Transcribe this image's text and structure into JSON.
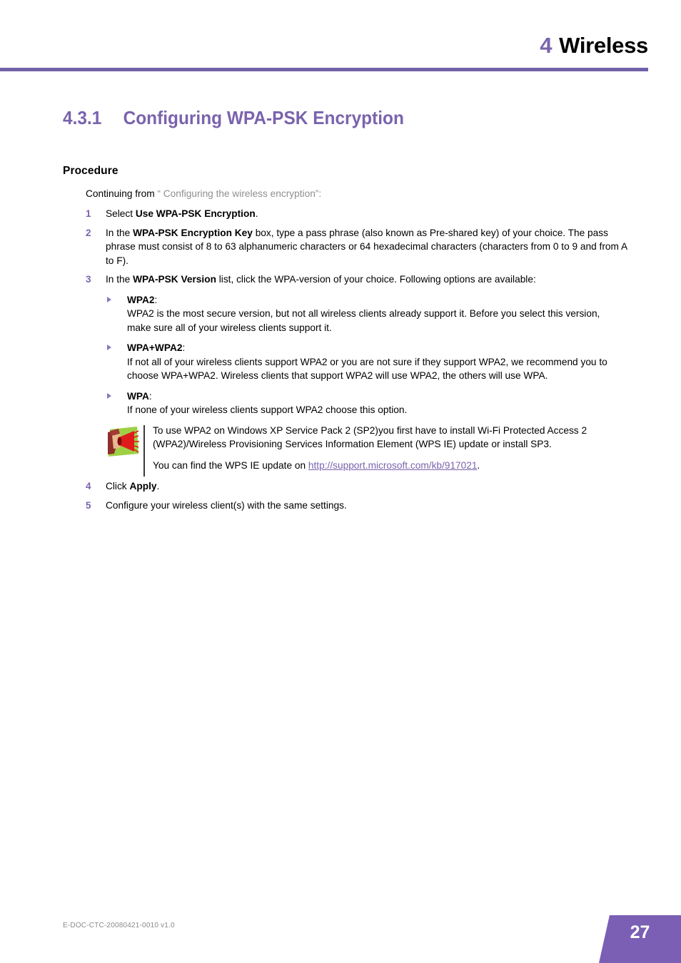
{
  "header": {
    "chapter_number": "4",
    "chapter_name": "Wireless",
    "accent_color": "#7161a8"
  },
  "section": {
    "number": "4.3.1",
    "title": "Configuring WPA-PSK Encryption"
  },
  "procedure": {
    "label": "Procedure",
    "intro_lead": "Continuing from",
    "intro_xref": "“ Configuring the wireless encryption”:",
    "steps": [
      {
        "number": "1",
        "parts": [
          {
            "text": "Select ",
            "bold": false
          },
          {
            "text": "Use WPA-PSK Encryption",
            "bold": true
          },
          {
            "text": ".",
            "bold": false
          }
        ]
      },
      {
        "number": "2",
        "parts": [
          {
            "text": "In the ",
            "bold": false
          },
          {
            "text": "WPA-PSK Encryption Key",
            "bold": true
          },
          {
            "text": " box, type a pass phrase (also known as Pre-shared key) of your choice. The pass phrase must consist of 8 to 63 alphanumeric characters or 64 hexadecimal characters (characters from 0 to 9 and from A to F).",
            "bold": false
          }
        ]
      },
      {
        "number": "3",
        "parts": [
          {
            "text": "In the ",
            "bold": false
          },
          {
            "text": "WPA-PSK Version",
            "bold": true
          },
          {
            "text": " list, click the WPA-version of your choice. Following options are available:",
            "bold": false
          }
        ]
      },
      {
        "number": "4",
        "parts": [
          {
            "text": "Click ",
            "bold": false
          },
          {
            "text": "Apply",
            "bold": true
          },
          {
            "text": ".",
            "bold": false
          }
        ]
      },
      {
        "number": "5",
        "parts": [
          {
            "text": "Configure your wireless client(s) with the same settings.",
            "bold": false
          }
        ]
      }
    ],
    "options": [
      {
        "name": "WPA2",
        "separator": ":",
        "description": "WPA2 is the most secure version, but not all wireless clients already support it. Before you select this version, make sure all of your wireless clients support it."
      },
      {
        "name": "WPA+WPA2",
        "separator": ":",
        "description": "If not all of your wireless clients support WPA2 or you are not sure if they support WPA2, we recommend you to choose WPA+WPA2. Wireless clients that support WPA2 will use WPA2, the others will use WPA."
      },
      {
        "name": "WPA",
        "separator": ":",
        "description": "If none of your wireless clients support WPA2 choose this option."
      }
    ]
  },
  "note": {
    "icon_name": "announcement-megaphone-icon",
    "paragraph_1": "To use WPA2 on Windows XP Service Pack 2 (SP2)you first have to install Wi-Fi Protected Access 2 (WPA2)/Wireless Provisioning Services Information Element (WPS IE) update or install SP3.",
    "paragraph_2_lead": "You can find the WPS IE update on ",
    "paragraph_2_link": "http://support.microsoft.com/kb/917021",
    "paragraph_2_tail": "."
  },
  "footer": {
    "document_code": "E-DOC-CTC-20080421-0010 v1.0",
    "page_number": "27"
  }
}
